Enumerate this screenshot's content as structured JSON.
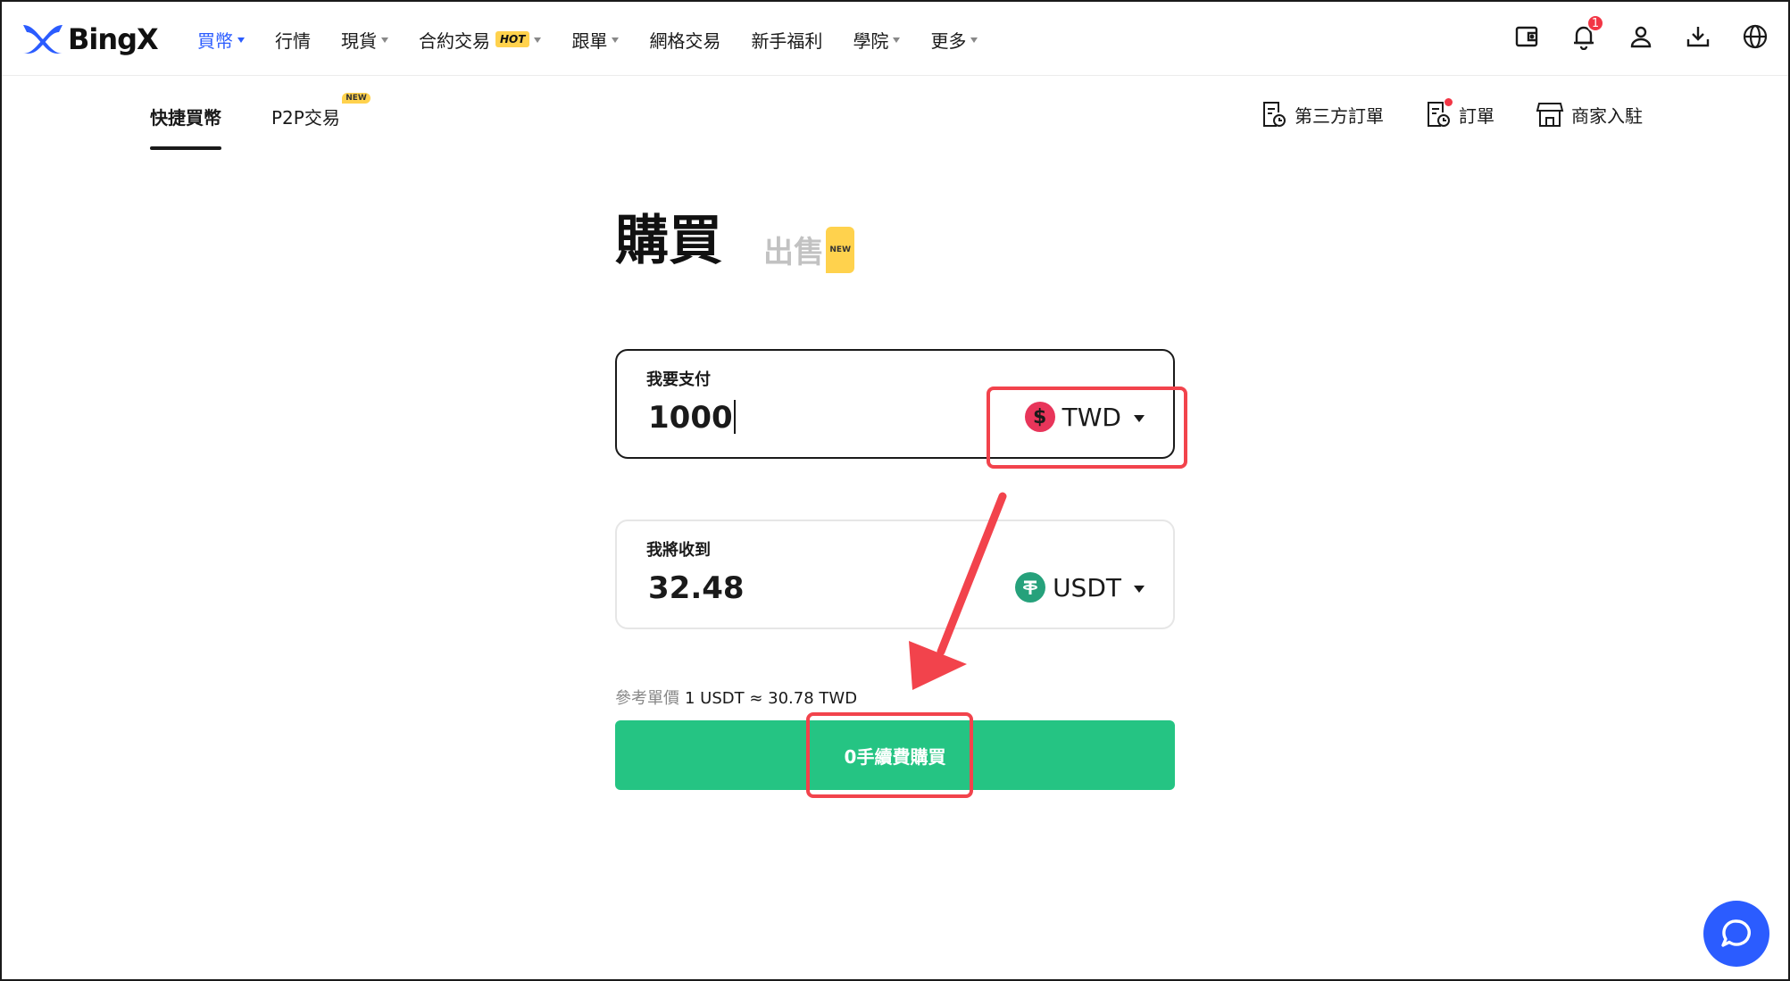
{
  "brand": {
    "name": "BingX",
    "accent": "#2b5cff",
    "buy_green": "#25c483",
    "highlight_red": "#f2434c"
  },
  "nav": {
    "items": [
      {
        "label": "買幣",
        "caret": true,
        "active": true
      },
      {
        "label": "行情",
        "caret": false
      },
      {
        "label": "現貨",
        "caret": true
      },
      {
        "label": "合約交易",
        "caret": true,
        "badge": "HOT"
      },
      {
        "label": "跟單",
        "caret": true
      },
      {
        "label": "網格交易",
        "caret": false
      },
      {
        "label": "新手福利",
        "caret": false
      },
      {
        "label": "學院",
        "caret": true
      },
      {
        "label": "更多",
        "caret": true
      }
    ],
    "icons": [
      "wallet-icon",
      "bell-icon",
      "user-icon",
      "download-icon",
      "globe-icon"
    ],
    "notification_count": "1"
  },
  "subnav": {
    "tabs": [
      {
        "label": "快捷買幣",
        "active": true
      },
      {
        "label": "P2P交易",
        "badge": "NEW"
      }
    ],
    "right": [
      {
        "label": "第三方訂單",
        "icon": "order-clock-icon"
      },
      {
        "label": "訂單",
        "icon": "order-clock-icon"
      },
      {
        "label": "商家入駐",
        "icon": "store-icon"
      }
    ]
  },
  "main": {
    "buy_title": "購買",
    "sell_title": "出售",
    "sell_badge": "NEW",
    "pay": {
      "label": "我要支付",
      "value": "1000",
      "currency": "TWD",
      "currency_symbol": "$"
    },
    "receive": {
      "label": "我將收到",
      "value": "32.48",
      "currency": "USDT"
    },
    "ref_label": "參考單價",
    "ref_value": "1 USDT ≈ 30.78 TWD",
    "buy_button": "0手續費購買"
  },
  "chat_icon": "chat-icon"
}
